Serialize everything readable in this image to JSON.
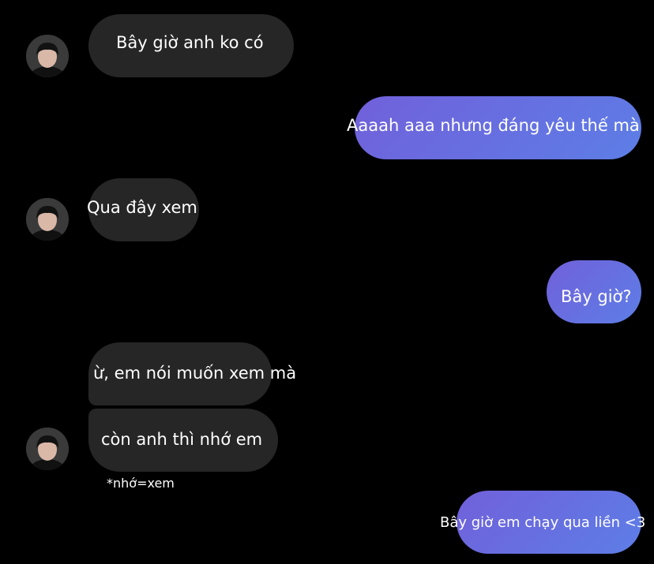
{
  "accent": {
    "incoming_bubble": "#262626",
    "outgoing_bubble_start": "#7160da",
    "outgoing_bubble_end": "#5d7ee6",
    "background": "#000000"
  },
  "contact": {
    "avatar_icon": "profile-photo-icon"
  },
  "messages": [
    {
      "direction": "incoming",
      "text": "Bây giờ anh ko có"
    },
    {
      "direction": "outgoing",
      "text": "Aaaah aaa nhưng đáng yêu thế mà"
    },
    {
      "direction": "incoming",
      "text": "Qua đây xem"
    },
    {
      "direction": "outgoing",
      "text": "Bây giờ?"
    },
    {
      "direction": "incoming",
      "text": "ừ, em nói muốn xem mà"
    },
    {
      "direction": "incoming",
      "text": "còn anh thì nhớ em"
    },
    {
      "direction": "outgoing",
      "text": "Bây giờ em chạy qua liền <3"
    }
  ],
  "annotation": {
    "text": "*nhớ=xem"
  }
}
